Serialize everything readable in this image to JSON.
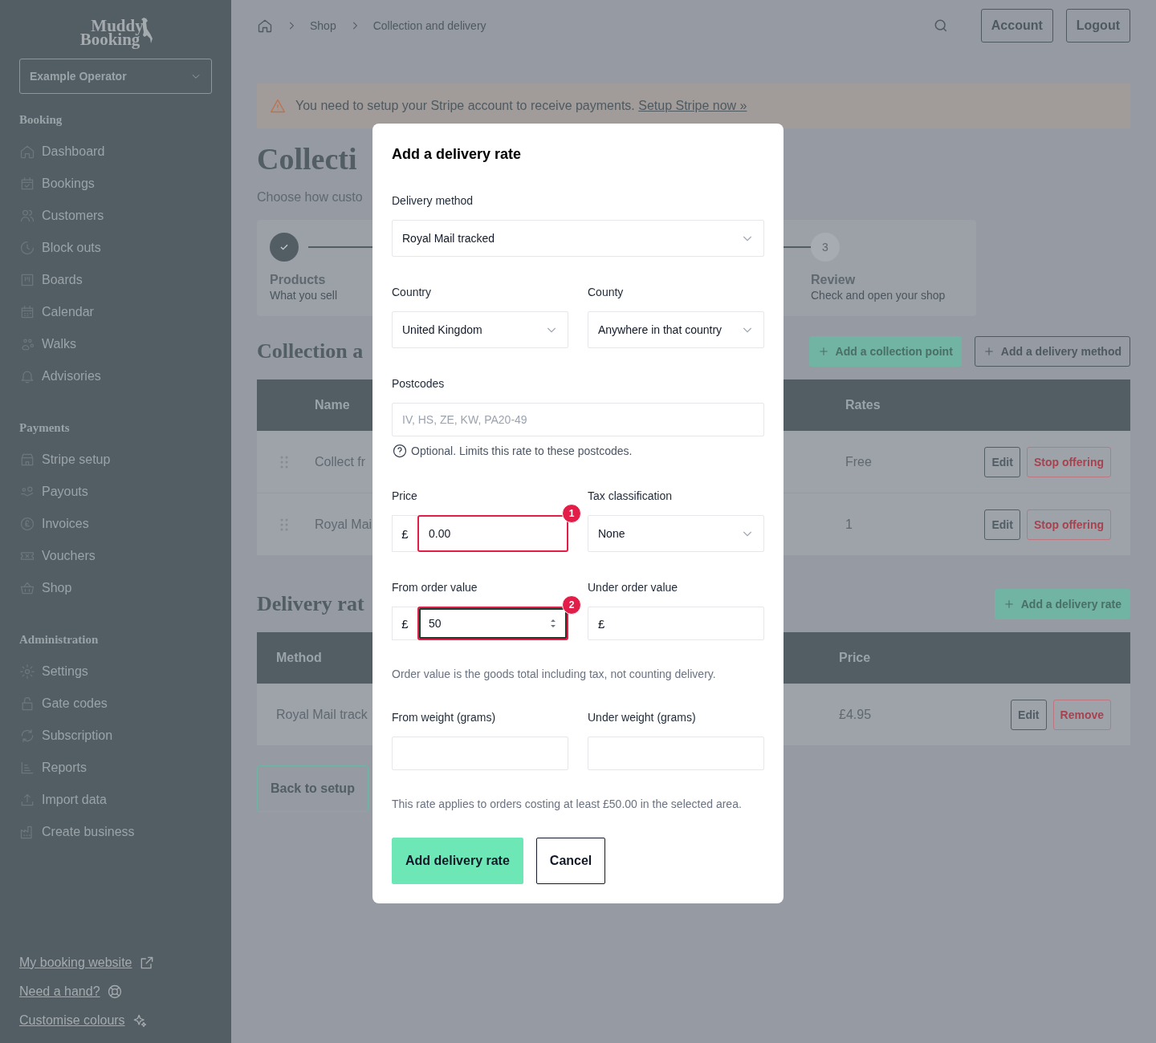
{
  "sidebar": {
    "logo": [
      "Muddy",
      "Booking"
    ],
    "operator_select": {
      "value": "Example Operator"
    },
    "sections": [
      {
        "title": "Booking",
        "items": [
          {
            "label": "Dashboard"
          },
          {
            "label": "Bookings"
          },
          {
            "label": "Customers"
          },
          {
            "label": "Block outs"
          },
          {
            "label": "Boards"
          },
          {
            "label": "Calendar"
          },
          {
            "label": "Walks"
          },
          {
            "label": "Advisories"
          }
        ]
      },
      {
        "title": "Payments",
        "items": [
          {
            "label": "Stripe setup"
          },
          {
            "label": "Payouts"
          },
          {
            "label": "Invoices"
          },
          {
            "label": "Vouchers"
          },
          {
            "label": "Shop"
          }
        ]
      },
      {
        "title": "Administration",
        "items": [
          {
            "label": "Settings"
          },
          {
            "label": "Gate codes"
          },
          {
            "label": "Subscription"
          },
          {
            "label": "Reports"
          },
          {
            "label": "Import data"
          },
          {
            "label": "Create business"
          }
        ]
      }
    ],
    "footer_links": [
      {
        "label": "My booking website"
      },
      {
        "label": "Need a hand?"
      },
      {
        "label": "Customise colours"
      }
    ]
  },
  "breadcrumb": [
    {
      "label": "Shop"
    },
    {
      "label": "Collection and delivery"
    }
  ],
  "header_buttons": [
    "Account",
    "Logout"
  ],
  "banner": {
    "message": "You need to setup your Stripe account to receive payments.",
    "link": "Setup Stripe now »"
  },
  "page_title": "Collecti",
  "page_subtitle": "Choose how custo",
  "steps": [
    {
      "title": "Products",
      "subtitle": "What you sell",
      "done": true
    },
    {
      "number": "3",
      "title": "Review",
      "subtitle": "Check and open your shop",
      "done": false
    }
  ],
  "collection_section": {
    "title": "Collection a",
    "buttons": [
      {
        "label": "Add a collection point",
        "kind": "primary"
      },
      {
        "label": "Add a delivery method",
        "kind": "outline"
      }
    ],
    "columns": [
      "Name",
      "Rates"
    ],
    "rows": [
      {
        "name": "Collect fr",
        "value": "Free",
        "actions": [
          {
            "label": "Edit",
            "kind": "neutral"
          },
          {
            "label": "Stop offering",
            "kind": "danger"
          }
        ]
      },
      {
        "name": "Royal Mai",
        "value": "1",
        "actions": [
          {
            "label": "Edit",
            "kind": "neutral"
          },
          {
            "label": "Stop offering",
            "kind": "danger"
          }
        ]
      }
    ]
  },
  "delivery_section": {
    "title": "Delivery rat",
    "buttons": [
      {
        "label": "Add a delivery rate",
        "kind": "primary"
      }
    ],
    "columns": [
      "Method",
      "Price"
    ],
    "rows": [
      {
        "name": "Royal Mail track",
        "value": "£4.95",
        "actions": [
          {
            "label": "Edit",
            "kind": "neutral"
          },
          {
            "label": "Remove",
            "kind": "danger"
          }
        ]
      }
    ]
  },
  "back_button": "Back to setup",
  "modal": {
    "title": "Add a delivery rate",
    "delivery_method": {
      "label": "Delivery method",
      "value": "Royal Mail tracked"
    },
    "country": {
      "label": "Country",
      "value": "United Kingdom"
    },
    "county": {
      "label": "County",
      "value": "Anywhere in that country"
    },
    "postcodes": {
      "label": "Postcodes",
      "placeholder": "IV, HS, ZE, KW, PA20-49",
      "hint": "Optional. Limits this rate to these postcodes."
    },
    "price": {
      "label": "Price",
      "prefix": "£",
      "value": "0.00",
      "marker": "1",
      "focused": false
    },
    "tax": {
      "label": "Tax classification",
      "value": "None"
    },
    "from_order": {
      "label": "From order value",
      "prefix": "£",
      "value": "50",
      "marker": "2",
      "focused": true
    },
    "under_order": {
      "label": "Under order value",
      "prefix": "£"
    },
    "order_note": "Order value is the goods total including tax, not counting delivery.",
    "from_weight": {
      "label": "From weight (grams)"
    },
    "under_weight": {
      "label": "Under weight (grams)"
    },
    "summary": "This rate applies to orders costing at least £50.00 in the selected area.",
    "buttons": [
      {
        "label": "Add delivery rate",
        "kind": "primary"
      },
      {
        "label": "Cancel",
        "kind": "secondary"
      }
    ]
  }
}
